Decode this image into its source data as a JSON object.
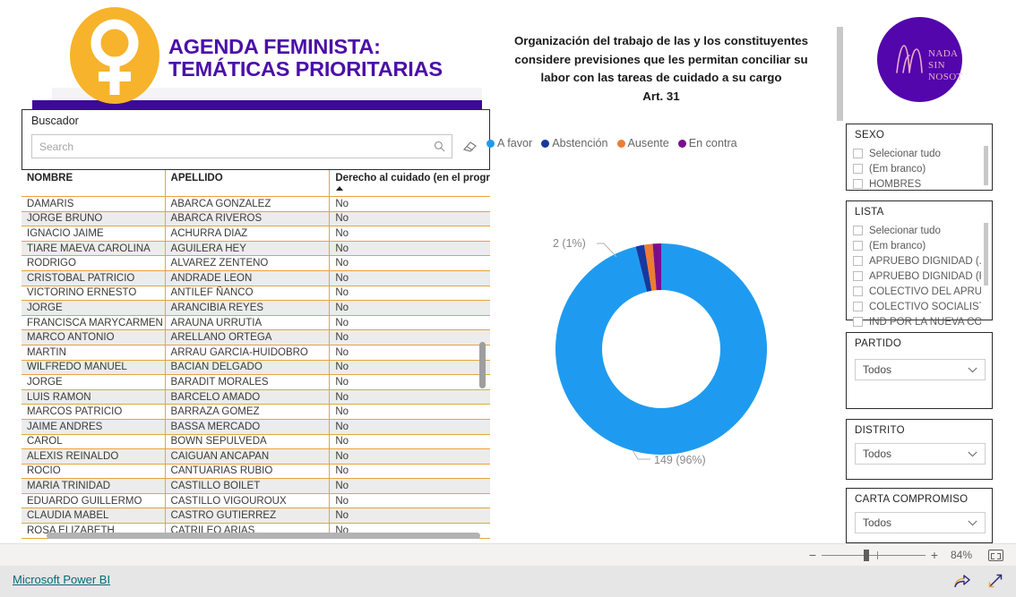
{
  "header": {
    "title_line1": "AGENDA FEMINISTA:",
    "title_line2": "TEMÁTICAS PRIORITARIAS",
    "venus_icon": "venus-symbol-icon",
    "bar_color": "#3d0b93",
    "circle_color": "#f7b32b",
    "title_color": "#4b0fa8"
  },
  "logo_right": {
    "line1": "NADA",
    "line2": "SIN",
    "line3": "NOSOTRAS",
    "bg_color": "#5206ab"
  },
  "search_panel": {
    "label": "Buscador",
    "placeholder": "Search",
    "value": "",
    "search_icon": "search-icon",
    "clear_icon": "eraser-icon"
  },
  "table": {
    "columns": [
      "NOMBRE",
      "APELLIDO",
      "Derecho al cuidado (en el progra"
    ],
    "sorted_column_index": 2,
    "sort_direction": "asc",
    "rows": [
      [
        "DAMARIS",
        "ABARCA GONZALEZ",
        "No"
      ],
      [
        "JORGE BRUNO",
        "ABARCA RIVEROS",
        "No"
      ],
      [
        "IGNACIO JAIME",
        "ACHURRA DIAZ",
        "No"
      ],
      [
        "TIARE MAEVA CAROLINA",
        "AGUILERA HEY",
        "No"
      ],
      [
        "RODRIGO",
        "ALVAREZ ZENTENO",
        "No"
      ],
      [
        "CRISTOBAL PATRICIO",
        "ANDRADE LEON",
        "No"
      ],
      [
        "VICTORINO ERNESTO",
        "ANTILEF ÑANCO",
        "No"
      ],
      [
        "JORGE",
        "ARANCIBIA REYES",
        "No"
      ],
      [
        "FRANCISCA MARYCARMEN",
        "ARAUNA URRUTIA",
        "No"
      ],
      [
        "MARCO ANTONIO",
        "ARELLANO ORTEGA",
        "No"
      ],
      [
        "MARTIN",
        "ARRAU GARCIA-HUIDOBRO",
        "No"
      ],
      [
        "WILFREDO MANUEL",
        "BACIAN DELGADO",
        "No"
      ],
      [
        "JORGE",
        "BARADIT MORALES",
        "No"
      ],
      [
        "LUIS RAMON",
        "BARCELO AMADO",
        "No"
      ],
      [
        "MARCOS PATRICIO",
        "BARRAZA GOMEZ",
        "No"
      ],
      [
        "JAIME ANDRES",
        "BASSA MERCADO",
        "No"
      ],
      [
        "CAROL",
        "BOWN SEPULVEDA",
        "No"
      ],
      [
        "ALEXIS REINALDO",
        "CAIGUAN ANCAPAN",
        "No"
      ],
      [
        "ROCIO",
        "CANTUARIAS RUBIO",
        "No"
      ],
      [
        "MARIA TRINIDAD",
        "CASTILLO BOILET",
        "No"
      ],
      [
        "EDUARDO GUILLERMO",
        "CASTILLO VIGOUROUX",
        "No"
      ],
      [
        "CLAUDIA MABEL",
        "CASTRO GUTIERREZ",
        "No"
      ],
      [
        "ROSA ELIZABETH",
        "CATRILEO ARIAS",
        "No"
      ]
    ]
  },
  "chart_data": {
    "type": "pie",
    "title": "Organización del trabajo de las y los constituyentes considere previsiones que les permitan conciliar su labor con las tareas de cuidado a su cargo\nArt. 31",
    "title_lines": [
      "Organización del trabajo de las y los constituyentes",
      "considere previsiones que les permitan conciliar su",
      "labor con las tareas de cuidado a su cargo",
      "Art. 31"
    ],
    "categories": [
      "A favor",
      "Abstención",
      "Ausente",
      "En contra"
    ],
    "values": [
      149,
      2,
      2,
      2
    ],
    "percentages": [
      96,
      1,
      1,
      1
    ],
    "colors": [
      "#1e9bf0",
      "#17389e",
      "#ed7d31",
      "#7a0f8e"
    ],
    "legend": [
      {
        "label": "A favor",
        "color": "#1e9bf0"
      },
      {
        "label": "Abstención",
        "color": "#17389e"
      },
      {
        "label": "Ausente",
        "color": "#ed7d31"
      },
      {
        "label": "En contra",
        "color": "#7a0f8e"
      }
    ],
    "data_labels": [
      {
        "text": "149 (96%)",
        "series": "A favor"
      },
      {
        "text": "2 (1%)",
        "series": "Abstención"
      }
    ],
    "legend_position": "top",
    "donut": true
  },
  "slicers": {
    "sexo": {
      "title": "SEXO",
      "items": [
        "Selecionar tudo",
        "(Em branco)",
        "HOMBRES"
      ]
    },
    "lista": {
      "title": "LISTA",
      "items": [
        "Selecionar tudo",
        "(Em branco)",
        "APRUEBO DIGNIDAD (...",
        "APRUEBO DIGNIDAD (F...",
        "COLECTIVO DEL APRUE...",
        "COLECTIVO SOCIALISTA",
        "IND POR LA NUEVA CO..."
      ]
    },
    "partido": {
      "title": "PARTIDO",
      "value": "Todos"
    },
    "distrito": {
      "title": "DISTRITO",
      "value": "Todos"
    },
    "carta": {
      "title": "CARTA COMPROMISO",
      "value": "Todos"
    }
  },
  "zoombar": {
    "minus": "−",
    "plus": "+",
    "percent": "84%",
    "fit_icon": "fit-to-page-icon"
  },
  "footer": {
    "link": "Microsoft Power BI",
    "share_icon": "share-icon",
    "fullscreen_icon": "fullscreen-icon"
  }
}
